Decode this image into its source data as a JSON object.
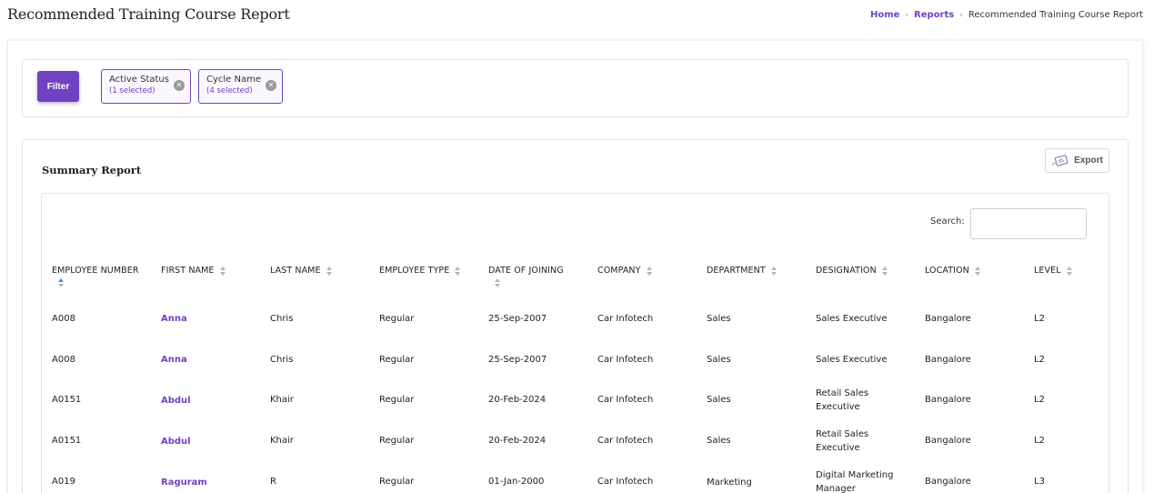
{
  "header": {
    "title": "Recommended Training Course Report",
    "breadcrumb": {
      "home": "Home",
      "reports": "Reports",
      "current": "Recommended Training Course Report"
    }
  },
  "filters": {
    "button_label": "Filter",
    "chips": [
      {
        "title": "Active Status",
        "sub": "(1 selected)"
      },
      {
        "title": "Cycle Name",
        "sub": "(4 selected)"
      }
    ]
  },
  "report": {
    "title": "Summary Report",
    "export_label": "Export",
    "search_label": "Search:",
    "search_value": ""
  },
  "table": {
    "columns": [
      "EMPLOYEE NUMBER",
      "FIRST NAME",
      "LAST NAME",
      "EMPLOYEE TYPE",
      "DATE OF JOINING",
      "COMPANY",
      "DEPARTMENT",
      "DESIGNATION",
      "LOCATION",
      "LEVEL"
    ],
    "rows": [
      [
        "A008",
        "Anna",
        "Chris",
        "Regular",
        "25-Sep-2007",
        "Car Infotech",
        "Sales",
        "Sales Executive",
        "Bangalore",
        "L2"
      ],
      [
        "A008",
        "Anna",
        "Chris",
        "Regular",
        "25-Sep-2007",
        "Car Infotech",
        "Sales",
        "Sales Executive",
        "Bangalore",
        "L2"
      ],
      [
        "A0151",
        "Abdul",
        "Khair",
        "Regular",
        "20-Feb-2024",
        "Car Infotech",
        "Sales",
        "Retail Sales Executive",
        "Bangalore",
        "L2"
      ],
      [
        "A0151",
        "Abdul",
        "Khair",
        "Regular",
        "20-Feb-2024",
        "Car Infotech",
        "Sales",
        "Retail Sales Executive",
        "Bangalore",
        "L2"
      ],
      [
        "A019",
        "Raguram",
        "R",
        "Regular",
        "01-Jan-2000",
        "Car Infotech",
        "Marketing",
        "Digital Marketing Manager",
        "Bangalore",
        "L3"
      ]
    ]
  },
  "colors": {
    "accent": "#6f42c1",
    "sort_active": "#3d8bd9"
  },
  "icons": {
    "chip_close": "close-circle-icon",
    "export": "export-file-icon",
    "sort": "sort-icon"
  }
}
